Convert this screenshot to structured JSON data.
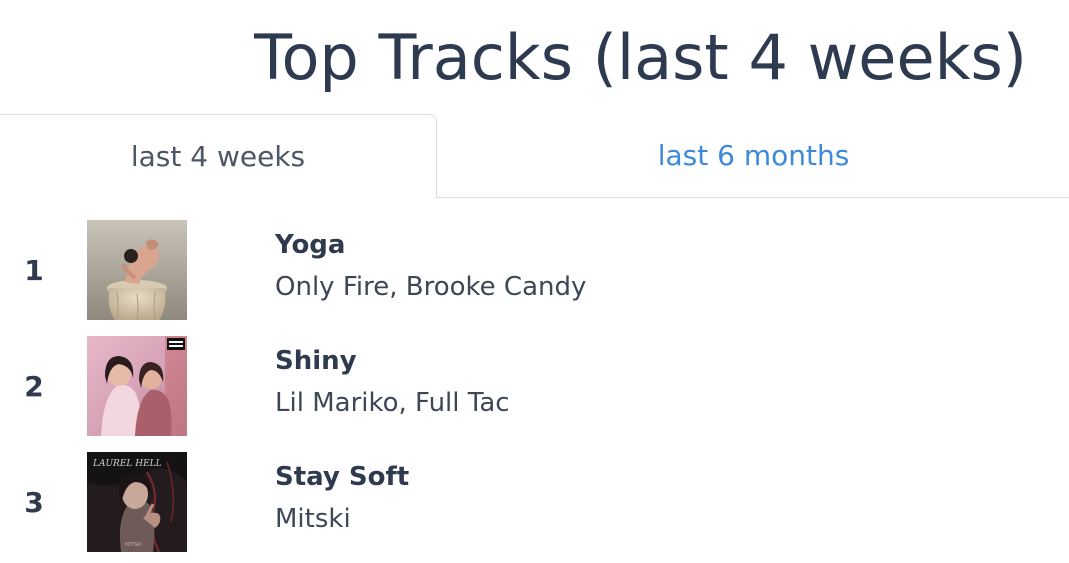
{
  "header": {
    "title": "Top Tracks (last 4 weeks)"
  },
  "tabs": [
    {
      "label": "last 4 weeks",
      "active": true
    },
    {
      "label": "last 6 months",
      "active": false
    }
  ],
  "colors": {
    "title": "#2e3a50",
    "active_tab_text": "#4d5666",
    "inactive_tab_text": "#3d8ad8",
    "divider": "#d9dce1"
  },
  "tracks": [
    {
      "rank": "1",
      "name": "Yoga",
      "artists": "Only Fire, Brooke Candy",
      "artwork": "album-art-yoga"
    },
    {
      "rank": "2",
      "name": "Shiny",
      "artists": "Lil Mariko, Full Tac",
      "artwork": "album-art-shiny"
    },
    {
      "rank": "3",
      "name": "Stay Soft",
      "artists": "Mitski",
      "artwork": "album-art-stay-soft"
    }
  ],
  "artwork_text": {
    "album3_title": "LAUREL HELL",
    "album3_artist": "MITSKI"
  }
}
